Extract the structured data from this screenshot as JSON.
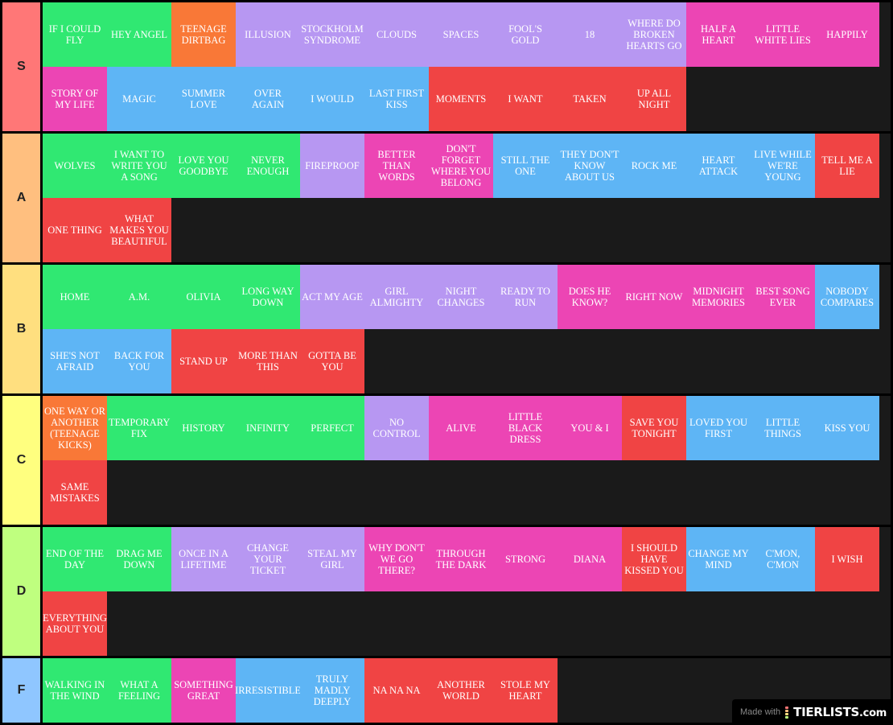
{
  "colors": {
    "green": "#30e872",
    "orange": "#f97837",
    "purple": "#b797f2",
    "pink": "#ec45b4",
    "blue": "#5eb5f5",
    "red": "#f04444"
  },
  "tiers": [
    {
      "label": "S",
      "color": "#ff7777",
      "items": [
        {
          "text": "IF I COULD FLY",
          "color": "green"
        },
        {
          "text": "HEY ANGEL",
          "color": "green"
        },
        {
          "text": "TEENAGE DIRTBAG",
          "color": "orange"
        },
        {
          "text": "ILLUSION",
          "color": "purple"
        },
        {
          "text": "STOCKHOLM SYNDROME",
          "color": "purple"
        },
        {
          "text": "CLOUDS",
          "color": "purple"
        },
        {
          "text": "SPACES",
          "color": "purple"
        },
        {
          "text": "FOOL'S GOLD",
          "color": "purple"
        },
        {
          "text": "18",
          "color": "purple"
        },
        {
          "text": "WHERE DO BROKEN HEARTS GO",
          "color": "purple"
        },
        {
          "text": "HALF A HEART",
          "color": "pink"
        },
        {
          "text": "LITTLE WHITE LIES",
          "color": "pink"
        },
        {
          "text": "HAPPILY",
          "color": "pink"
        },
        {
          "text": "STORY OF MY LIFE",
          "color": "pink"
        },
        {
          "text": "MAGIC",
          "color": "blue"
        },
        {
          "text": "SUMMER LOVE",
          "color": "blue"
        },
        {
          "text": "OVER AGAIN",
          "color": "blue"
        },
        {
          "text": "I WOULD",
          "color": "blue"
        },
        {
          "text": "LAST FIRST KISS",
          "color": "blue"
        },
        {
          "text": "MOMENTS",
          "color": "red"
        },
        {
          "text": "I WANT",
          "color": "red"
        },
        {
          "text": "TAKEN",
          "color": "red"
        },
        {
          "text": "UP ALL NIGHT",
          "color": "red"
        }
      ]
    },
    {
      "label": "A",
      "color": "#ffbf7f",
      "items": [
        {
          "text": "WOLVES",
          "color": "green"
        },
        {
          "text": "I WANT TO WRITE YOU A SONG",
          "color": "green"
        },
        {
          "text": "LOVE YOU GOODBYE",
          "color": "green"
        },
        {
          "text": "NEVER ENOUGH",
          "color": "green"
        },
        {
          "text": "FIREPROOF",
          "color": "purple"
        },
        {
          "text": "BETTER THAN WORDS",
          "color": "pink"
        },
        {
          "text": "DON'T FORGET WHERE YOU BELONG",
          "color": "pink"
        },
        {
          "text": "STILL THE ONE",
          "color": "blue"
        },
        {
          "text": "THEY DON'T KNOW ABOUT US",
          "color": "blue"
        },
        {
          "text": "ROCK ME",
          "color": "blue"
        },
        {
          "text": "HEART ATTACK",
          "color": "blue"
        },
        {
          "text": "LIVE WHILE WE'RE YOUNG",
          "color": "blue"
        },
        {
          "text": "TELL ME A LIE",
          "color": "red"
        },
        {
          "text": "ONE THING",
          "color": "red"
        },
        {
          "text": "WHAT MAKES YOU BEAUTIFUL",
          "color": "red"
        }
      ]
    },
    {
      "label": "B",
      "color": "#ffdf7f",
      "items": [
        {
          "text": "HOME",
          "color": "green"
        },
        {
          "text": "A.M.",
          "color": "green"
        },
        {
          "text": "OLIVIA",
          "color": "green"
        },
        {
          "text": "LONG WAY DOWN",
          "color": "green"
        },
        {
          "text": "ACT MY AGE",
          "color": "purple"
        },
        {
          "text": "GIRL ALMIGHTY",
          "color": "purple"
        },
        {
          "text": "NIGHT CHANGES",
          "color": "purple"
        },
        {
          "text": "READY TO RUN",
          "color": "purple"
        },
        {
          "text": "DOES HE KNOW?",
          "color": "pink"
        },
        {
          "text": "RIGHT NOW",
          "color": "pink"
        },
        {
          "text": "MIDNIGHT MEMORIES",
          "color": "pink"
        },
        {
          "text": "BEST SONG EVER",
          "color": "pink"
        },
        {
          "text": "NOBODY COMPARES",
          "color": "blue"
        },
        {
          "text": "SHE'S NOT AFRAID",
          "color": "blue"
        },
        {
          "text": "BACK FOR YOU",
          "color": "blue"
        },
        {
          "text": "STAND UP",
          "color": "red"
        },
        {
          "text": "MORE THAN THIS",
          "color": "red"
        },
        {
          "text": "GOTTA BE YOU",
          "color": "red"
        }
      ]
    },
    {
      "label": "C",
      "color": "#ffff7f",
      "items": [
        {
          "text": "ONE WAY OR ANOTHER (TEENAGE KICKS)",
          "color": "orange"
        },
        {
          "text": "TEMPORARY FIX",
          "color": "green"
        },
        {
          "text": "HISTORY",
          "color": "green"
        },
        {
          "text": "INFINITY",
          "color": "green"
        },
        {
          "text": "PERFECT",
          "color": "green"
        },
        {
          "text": "NO CONTROL",
          "color": "purple"
        },
        {
          "text": "ALIVE",
          "color": "pink"
        },
        {
          "text": "LITTLE BLACK DRESS",
          "color": "pink"
        },
        {
          "text": "YOU & I",
          "color": "pink"
        },
        {
          "text": "SAVE YOU TONIGHT",
          "color": "red"
        },
        {
          "text": "LOVED YOU FIRST",
          "color": "blue"
        },
        {
          "text": "LITTLE THINGS",
          "color": "blue"
        },
        {
          "text": "KISS YOU",
          "color": "blue"
        },
        {
          "text": "SAME MISTAKES",
          "color": "red"
        }
      ]
    },
    {
      "label": "D",
      "color": "#bfff7f",
      "items": [
        {
          "text": "END OF THE DAY",
          "color": "green"
        },
        {
          "text": "DRAG ME DOWN",
          "color": "green"
        },
        {
          "text": "ONCE IN A LIFETIME",
          "color": "purple"
        },
        {
          "text": "CHANGE YOUR TICKET",
          "color": "purple"
        },
        {
          "text": "STEAL MY GIRL",
          "color": "purple"
        },
        {
          "text": "WHY DON'T WE GO THERE?",
          "color": "pink"
        },
        {
          "text": "THROUGH THE DARK",
          "color": "pink"
        },
        {
          "text": "STRONG",
          "color": "pink"
        },
        {
          "text": "DIANA",
          "color": "pink"
        },
        {
          "text": "I SHOULD HAVE KISSED YOU",
          "color": "red"
        },
        {
          "text": "CHANGE MY MIND",
          "color": "blue"
        },
        {
          "text": "C'MON, C'MON",
          "color": "blue"
        },
        {
          "text": "I WISH",
          "color": "red"
        },
        {
          "text": "EVERYTHING ABOUT YOU",
          "color": "red"
        }
      ]
    },
    {
      "label": "F",
      "color": "#8fc6ff",
      "items": [
        {
          "text": "WALKING IN THE WIND",
          "color": "green"
        },
        {
          "text": "WHAT A FEELING",
          "color": "green"
        },
        {
          "text": "SOMETHING GREAT",
          "color": "pink"
        },
        {
          "text": "IRRESISTIBLE",
          "color": "blue"
        },
        {
          "text": "TRULY MADLY DEEPLY",
          "color": "blue"
        },
        {
          "text": "NA NA NA",
          "color": "red"
        },
        {
          "text": "ANOTHER WORLD",
          "color": "red"
        },
        {
          "text": "STOLE MY HEART",
          "color": "red"
        }
      ]
    }
  ],
  "watermark": {
    "prefix": "Made with",
    "brand": "TIERLISTS",
    "suffix": ".com",
    "dot_colors": [
      "#ff7777",
      "#ffbf7f",
      "#ffdf7f",
      "#bfff7f"
    ]
  }
}
